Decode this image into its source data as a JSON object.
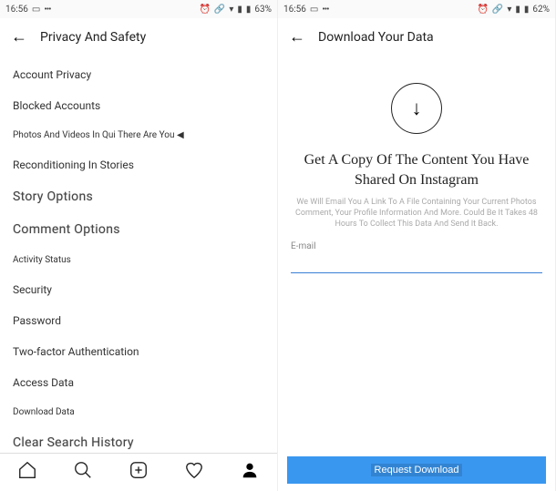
{
  "left": {
    "status": {
      "time": "16:56",
      "battery": "63%",
      "alarm": "⏰",
      "link": "🔗",
      "wifi": "▾",
      "signal": "▮",
      "rect": "▭",
      "dots": "•••"
    },
    "header": {
      "title": "Privacy And Safety"
    },
    "menu": {
      "account_privacy": "Account Privacy",
      "blocked_accounts": "Blocked Accounts",
      "photos_videos": "Photos And Videos In Qui There Are You ◀",
      "reconditioning": "Reconditioning In Stories",
      "story_options": "Story Options",
      "comment_options": "Comment Options",
      "activity_status": "Activity Status",
      "security": "Security",
      "password": "Password",
      "two_factor": "Two-factor Authentication",
      "access_data": "Access Data",
      "download_data": "Download Data",
      "clear_history": "Clear Search History"
    },
    "nav": {
      "home": "⌂",
      "search": "Q",
      "add": "⊞",
      "activity": "♡",
      "profile": "👤"
    }
  },
  "right": {
    "status": {
      "time": "16:56",
      "battery": "62%",
      "alarm": "⏰",
      "link": "🔗",
      "wifi": "▾",
      "signal": "▮",
      "rect": "▭",
      "dots": "•••"
    },
    "header": {
      "title": "Download Your Data"
    },
    "icon_glyph": "↓",
    "big_title": "Get A Copy Of The Content You Have Shared On Instagram",
    "sub_desc": "We Will Email You A Link To A File Containing Your Current Photos Comment, Your Profile Information And More. Could Be It Takes 48 Hours To Collect This Data And Send It Back.",
    "email_label": "E-mail",
    "email_value": "",
    "request_btn": "Request Download"
  }
}
